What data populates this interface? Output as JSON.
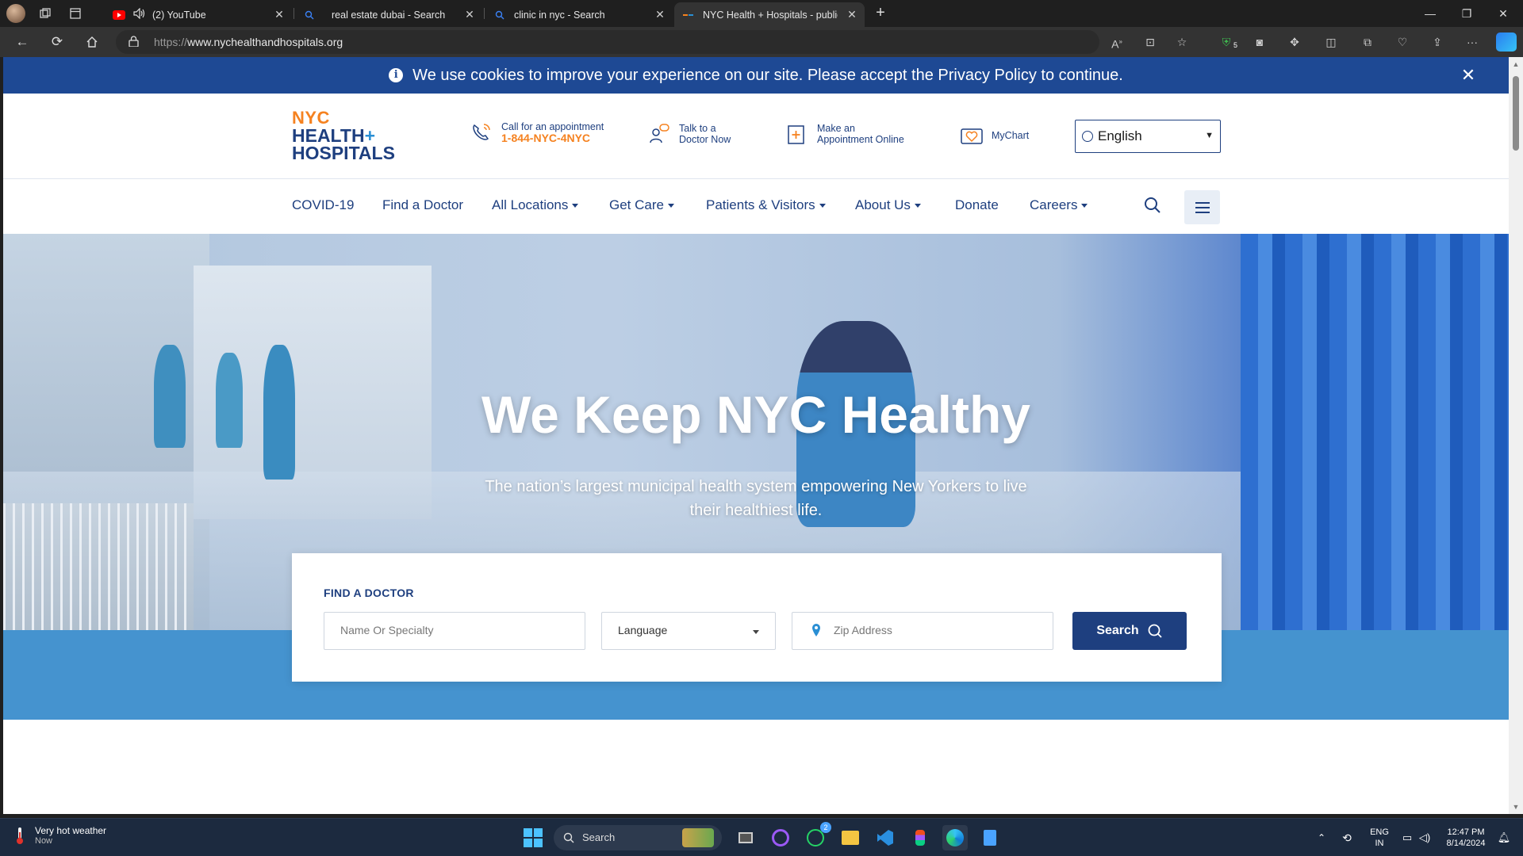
{
  "browser": {
    "tabs": [
      {
        "title": "(2) YouTube",
        "icon": "youtube-icon"
      },
      {
        "title": "real estate dubai - Search",
        "icon": "search-icon"
      },
      {
        "title": "clinic in nyc - Search",
        "icon": "search-icon"
      },
      {
        "title": "NYC Health + Hospitals - public",
        "icon": "nychh-icon"
      }
    ],
    "url_prefix": "https://",
    "url_host": "www.nychealthandhospitals.org",
    "extension_badge": "5"
  },
  "cookie_banner": {
    "text": "We use cookies to improve your experience on our site. Please accept the Privacy Policy to continue."
  },
  "header": {
    "logo_line1": "NYC",
    "logo_line2": "HEALTH",
    "logo_plus": "+",
    "logo_line3": "HOSPITALS",
    "call_label": "Call for an appointment",
    "call_number": "1-844-NYC-4NYC",
    "talk_line1": "Talk to a",
    "talk_line2": "Doctor Now",
    "appt_line1": "Make an",
    "appt_line2": "Appointment Online",
    "mychart": "MyChart",
    "language_selected": "English"
  },
  "nav": {
    "items": [
      "COVID-19",
      "Find a Doctor",
      "All Locations",
      "Get Care",
      "Patients & Visitors",
      "About Us",
      "Donate",
      "Careers"
    ]
  },
  "hero": {
    "title": "We Keep NYC Healthy",
    "subtitle": "The nation’s largest municipal health system empowering New Yorkers to live their healthiest life."
  },
  "find_doctor": {
    "label": "FIND A DOCTOR",
    "name_placeholder": "Name Or Specialty",
    "language_placeholder": "Language",
    "zip_placeholder": "Zip Address",
    "search_button": "Search"
  },
  "taskbar": {
    "weather_title": "Very hot weather",
    "weather_sub": "Now",
    "search_label": "Search",
    "whatsapp_badge": "2",
    "lang_line1": "ENG",
    "lang_line2": "IN",
    "time": "12:47 PM",
    "date": "8/14/2024"
  },
  "colors": {
    "brand_navy": "#1e3f7f",
    "brand_orange": "#f58220",
    "cookie_bg": "#1e4994",
    "band_blue": "#4593cf"
  }
}
